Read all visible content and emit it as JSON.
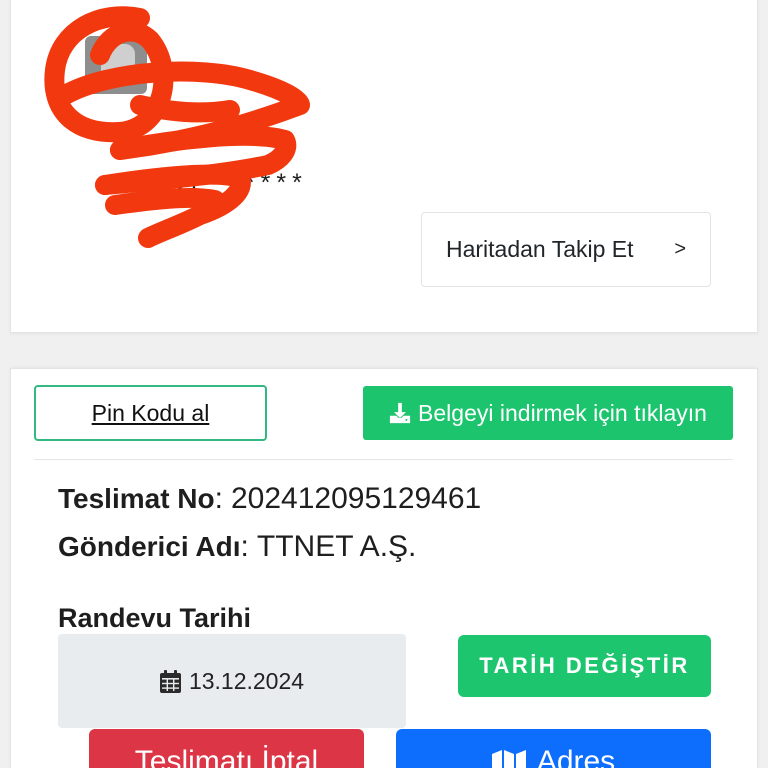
{
  "tracking_card": {
    "avatar_icon": "avatar",
    "recipient_name_masked": "ERDE******",
    "map_follow_button": {
      "label": "Haritadan Takip Et",
      "chevron": ">"
    }
  },
  "delivery_card": {
    "pin_button_label": "Pin Kodu al",
    "download_button": {
      "icon": "download-icon",
      "label": "Belgeyi indirmek için tıklayın"
    },
    "separator": ":",
    "delivery_no": {
      "label": "Teslimat No",
      "value": "202412095129461"
    },
    "sender": {
      "label": "Gönderici Adı",
      "value": "TTNET A.Ş."
    },
    "appointment": {
      "label": "Randevu Tarihi",
      "icon": "calendar-icon",
      "date": "13.12.2024",
      "change_button_label": "TARİH DEĞİŞTİR"
    },
    "cancel_button_label": "Teslimatı İptal",
    "address_button": {
      "icon": "map-icon",
      "label": "Adres"
    }
  },
  "colors": {
    "page_bg": "#f0f0f0",
    "accent_green": "#1dc46e",
    "pin_border": "#33b882",
    "date_box": "#e9ecef",
    "danger": "#dc3545",
    "primary": "#0d6efd",
    "redaction": "#f2380f"
  }
}
